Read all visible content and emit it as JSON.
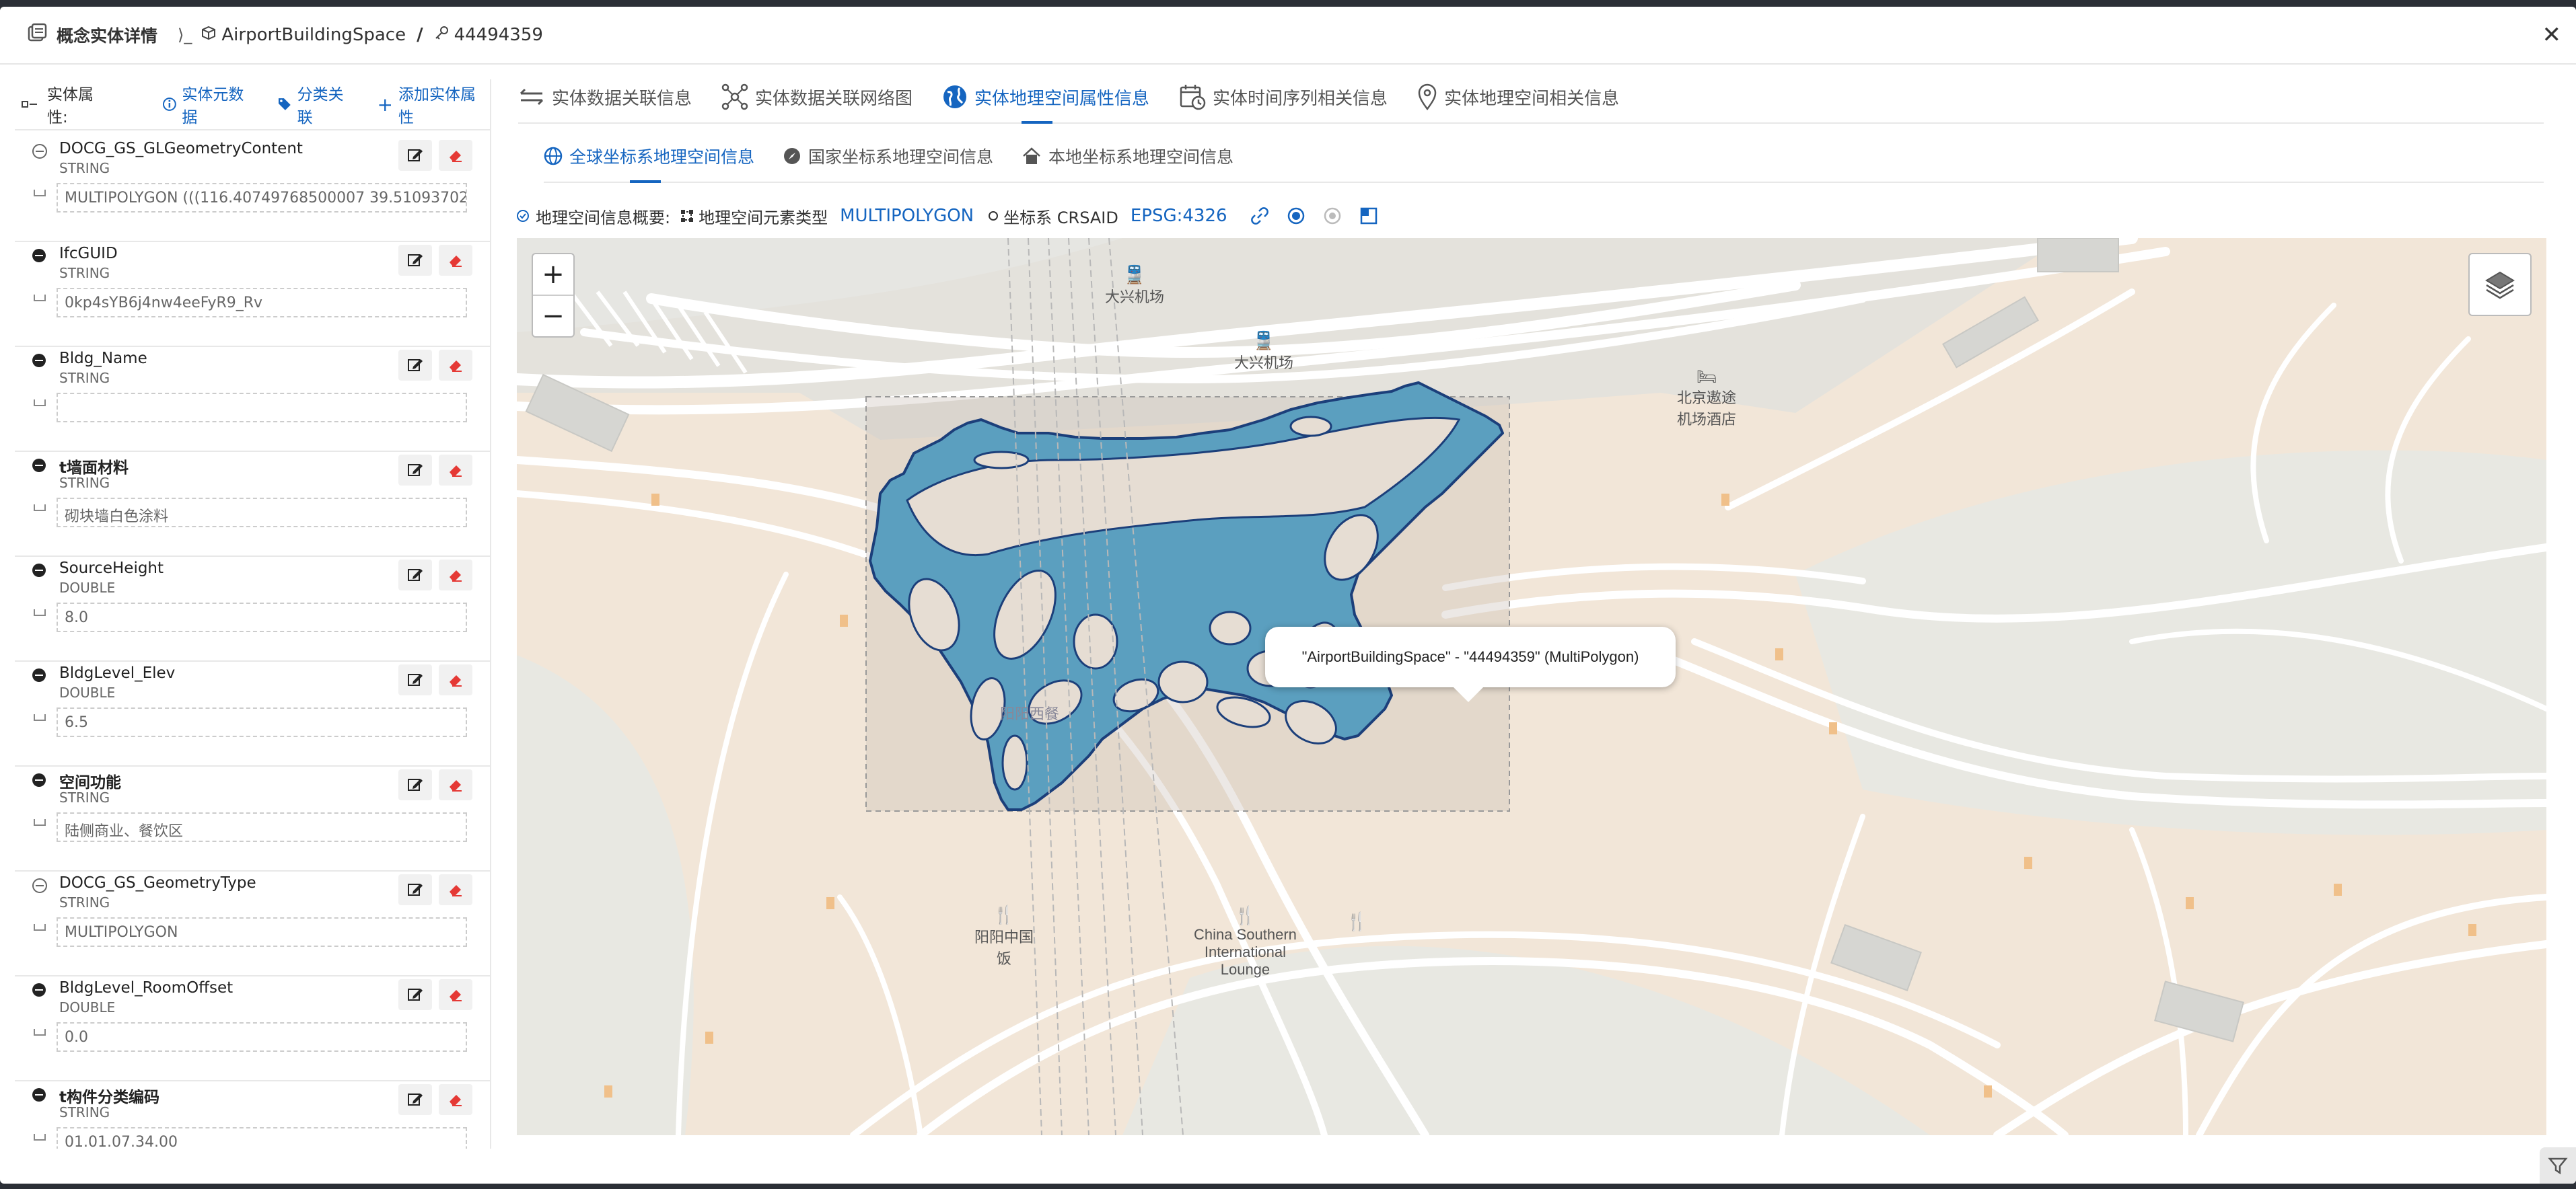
{
  "header": {
    "title": "概念实体详情",
    "separator": "⟩_",
    "entity_type": "AirportBuildingSpace",
    "slash": "/",
    "entity_id": "44494359"
  },
  "left_panel": {
    "label": "实体属性:",
    "links": [
      "实体元数据",
      "分类关联",
      "添加实体属性"
    ],
    "attributes": [
      {
        "name": "DOCG_GS_GLGeometryContent",
        "type": "STRING",
        "value": "MULTIPOLYGON (((116.40749768500007 39.510937027",
        "bold": false
      },
      {
        "name": "IfcGUID",
        "type": "STRING",
        "value": "0kp4sYB6j4nw4eeFyR9_Rv",
        "bold": false
      },
      {
        "name": "Bldg_Name",
        "type": "STRING",
        "value": "",
        "bold": false
      },
      {
        "name": "t墙面材料",
        "type": "STRING",
        "value": "砌块墙白色涂料",
        "bold": true
      },
      {
        "name": "SourceHeight",
        "type": "DOUBLE",
        "value": "8.0",
        "bold": false
      },
      {
        "name": "BldgLevel_Elev",
        "type": "DOUBLE",
        "value": "6.5",
        "bold": false
      },
      {
        "name": "空间功能",
        "type": "STRING",
        "value": "陆侧商业、餐饮区",
        "bold": true
      },
      {
        "name": "DOCG_GS_GeometryType",
        "type": "STRING",
        "value": "MULTIPOLYGON",
        "bold": false
      },
      {
        "name": "BldgLevel_RoomOffset",
        "type": "DOUBLE",
        "value": "0.0",
        "bold": false
      },
      {
        "name": "t构件分类编码",
        "type": "STRING",
        "value": "01.01.07.34.00",
        "bold": true
      }
    ]
  },
  "tabs": [
    "实体数据关联信息",
    "实体数据关联网络图",
    "实体地理空间属性信息",
    "实体时间序列相关信息",
    "实体地理空间相关信息"
  ],
  "active_tab": 2,
  "subtabs": [
    "全球坐标系地理空间信息",
    "国家坐标系地理空间信息",
    "本地坐标系地理空间信息"
  ],
  "active_subtab": 0,
  "summary": {
    "label": "地理空间信息概要:",
    "element_type_label": "地理空间元素类型",
    "element_type": "MULTIPOLYGON",
    "crs_label": "坐标系 CRSAID",
    "crs": "EPSG:4326"
  },
  "map": {
    "zoom_in": "+",
    "zoom_out": "−",
    "popup": "\"AirportBuildingSpace\" - \"44494359\" (MultiPolygon)",
    "labels": {
      "daxing1": "大兴机场",
      "daxing2": "大兴机场",
      "hotel_line1": "北京遨途",
      "hotel_line2": "机场酒店",
      "yangyang_line1": "阳阳中国",
      "yangyang_line2": "饭",
      "csa_line1": "China Southern",
      "csa_line2": "International",
      "csa_line3": "Lounge",
      "faded": "阳阳西餐"
    }
  },
  "colors": {
    "accent": "#1565c0",
    "polygon_fill": "#5b9fbf",
    "polygon_stroke": "#1c3f7a",
    "delete_red": "#e53935"
  }
}
